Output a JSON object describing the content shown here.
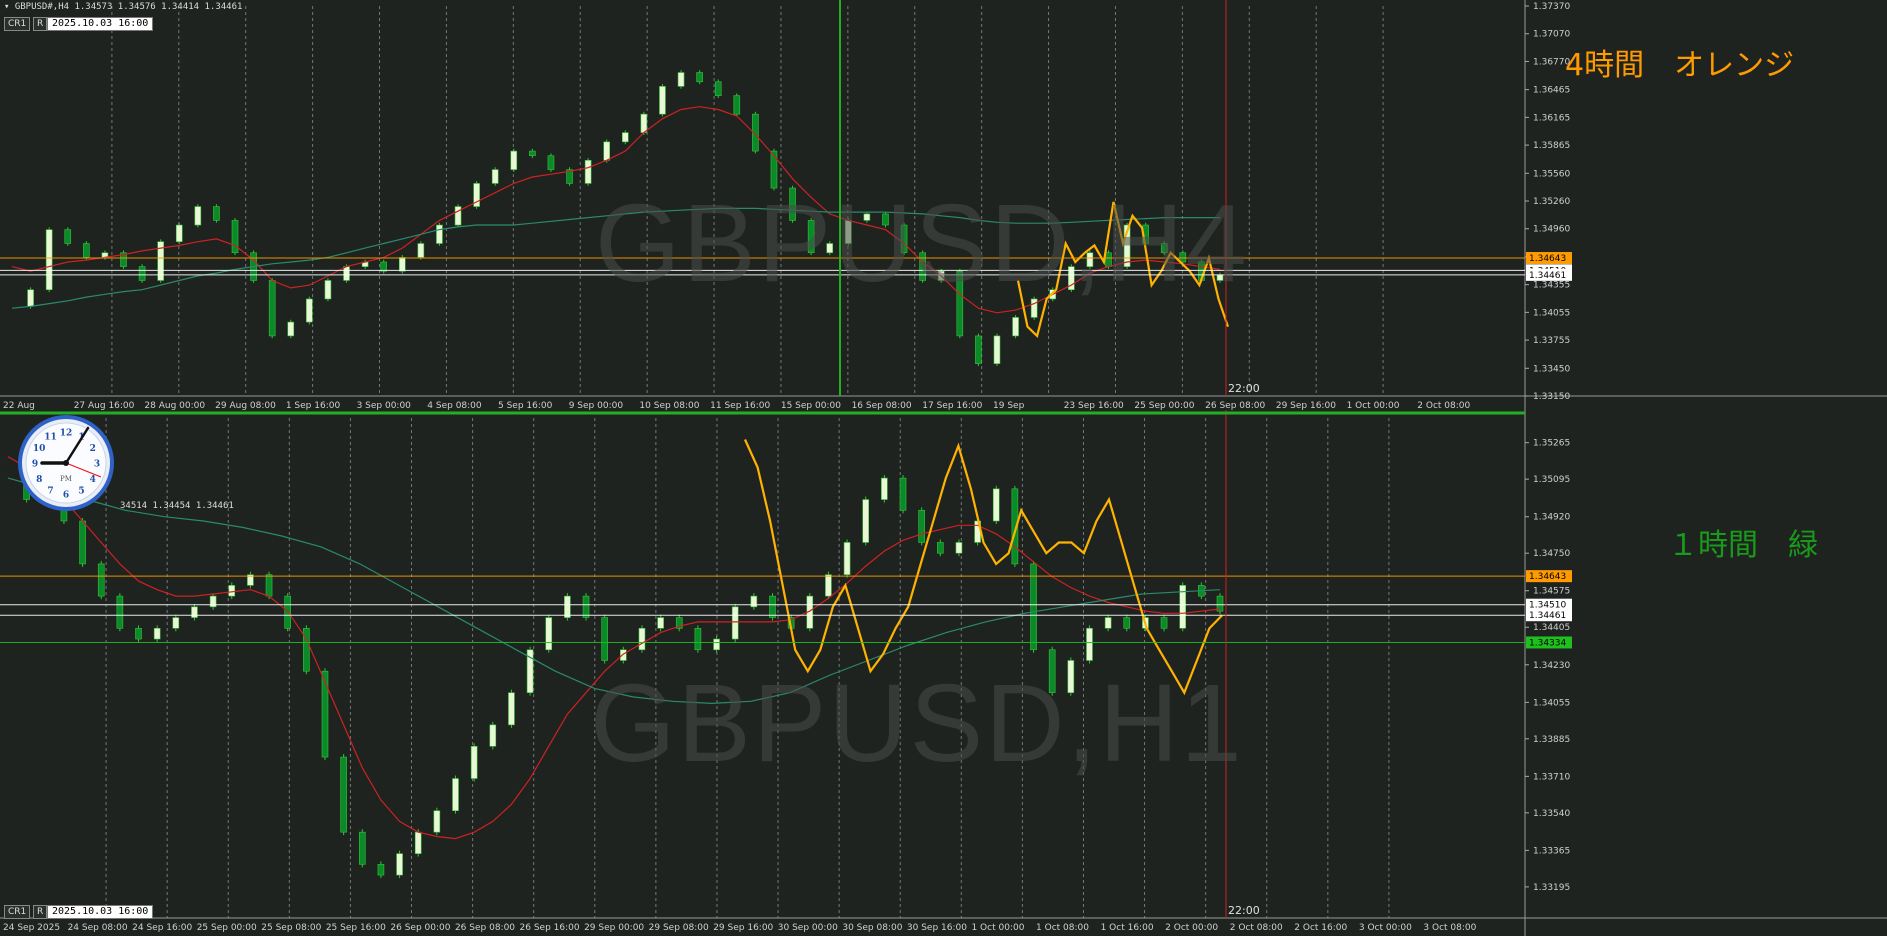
{
  "top": {
    "header_symbol": "GBPUSD#,H4",
    "header_ohlc": "1.34573 1.34576 1.34414 1.34461",
    "cr1_label": "CR1",
    "r_label": "R",
    "date_box": "2025.10.03 16:00",
    "watermark": "GBPUSD,H4",
    "note": "4時間　オレンジ",
    "note_color": "#ff9b00",
    "end_time_label": "22:00",
    "ylim": [
      1.3315,
      1.3737
    ],
    "price_ticks": [
      "1.37370",
      "1.37070",
      "1.36770",
      "1.36465",
      "1.36165",
      "1.35865",
      "1.35560",
      "1.35260",
      "1.34960",
      "1.34655",
      "1.34355",
      "1.34055",
      "1.33755",
      "1.33450",
      "1.33150"
    ],
    "time_ticks": [
      "22 Aug",
      "27 Aug 16:00",
      "28 Aug 00:00",
      "29 Aug 08:00",
      "1 Sep 16:00",
      "3 Sep 00:00",
      "4 Sep 08:00",
      "5 Sep 16:00",
      "9 Sep 00:00",
      "10 Sep 08:00",
      "11 Sep 16:00",
      "15 Sep 00:00",
      "16 Sep 08:00",
      "17 Sep 16:00",
      "19 Sep",
      "23 Sep 16:00",
      "25 Sep 00:00",
      "26 Sep 08:00",
      "29 Sep 16:00",
      "1 Oct 00:00",
      "2 Oct 08:00"
    ],
    "price_labels": [
      {
        "text": "1.34643",
        "value": 1.34643,
        "color": "#ff9b00"
      },
      {
        "text": "1.34510",
        "value": 1.3451,
        "color": "#ffffff"
      },
      {
        "text": "1.34461",
        "value": 1.34461,
        "color": "#ffffff"
      }
    ]
  },
  "bottom": {
    "header_ohlc": "34514 1.34454 1.34461",
    "cr1_label": "CR1",
    "r_label": "R",
    "date_box": "2025.10.03 16:00",
    "watermark": "GBPUSD,H1",
    "note": "１時間　緑",
    "note_color": "#1a9a1a",
    "end_time_label": "22:00",
    "ylim": [
      1.3305,
      1.3538
    ],
    "price_ticks": [
      "1.35265",
      "1.35095",
      "1.34920",
      "1.34750",
      "1.34575",
      "1.34405",
      "1.34230",
      "1.34055",
      "1.33885",
      "1.33710",
      "1.33540",
      "1.33365",
      "1.33195"
    ],
    "time_ticks": [
      "24 Sep 2025",
      "24 Sep 08:00",
      "24 Sep 16:00",
      "25 Sep 00:00",
      "25 Sep 08:00",
      "25 Sep 16:00",
      "26 Sep 00:00",
      "26 Sep 08:00",
      "26 Sep 16:00",
      "29 Sep 00:00",
      "29 Sep 08:00",
      "29 Sep 16:00",
      "30 Sep 00:00",
      "30 Sep 08:00",
      "30 Sep 16:00",
      "1 Oct 00:00",
      "1 Oct 08:00",
      "1 Oct 16:00",
      "2 Oct 00:00",
      "2 Oct 08:00",
      "2 Oct 16:00",
      "3 Oct 00:00",
      "3 Oct 08:00"
    ],
    "price_labels": [
      {
        "text": "1.34643",
        "value": 1.34643,
        "color": "#ff9b00"
      },
      {
        "text": "1.34510",
        "value": 1.3451,
        "color": "#ffffff"
      },
      {
        "text": "1.34461",
        "value": 1.34461,
        "color": "#ffffff"
      },
      {
        "text": "1.34334",
        "value": 1.34334,
        "color": "#1fbf1f"
      }
    ]
  },
  "clock": {
    "pm_label": "PM",
    "numbers": [
      "12",
      "1",
      "2",
      "3",
      "4",
      "5",
      "6",
      "7",
      "8",
      "9",
      "10",
      "11"
    ]
  },
  "chart_data": [
    {
      "type": "line",
      "title": "",
      "ylim": [
        1.3315,
        1.3737
      ],
      "series": [
        {
          "name": "",
          "y": [
            1.3412,
            1.343,
            1.3495,
            1.348,
            1.3465,
            1.347,
            1.3455,
            1.344,
            1.3482,
            1.35,
            1.352,
            1.3505,
            1.347,
            1.344,
            1.338,
            1.3395,
            1.342,
            1.344,
            1.3455,
            1.346,
            1.345,
            1.3465,
            1.348,
            1.35,
            1.352,
            1.3545,
            1.356,
            1.358,
            1.3575,
            1.356,
            1.3545,
            1.357,
            1.359,
            1.36,
            1.362,
            1.365,
            1.3665,
            1.3655,
            1.364,
            1.362,
            1.358,
            1.354,
            1.3505,
            1.347,
            1.348,
            1.3505,
            1.3512,
            1.35,
            1.347,
            1.344,
            1.345,
            1.338,
            1.335,
            1.338,
            1.34,
            1.342,
            1.343,
            1.3455,
            1.347,
            1.3455,
            1.35,
            1.348,
            1.347,
            1.346,
            1.344,
            1.3446
          ]
        },
        {
          "name": "",
          "y": [
            1.3455,
            1.345,
            1.3455,
            1.346,
            1.3462,
            1.3465,
            1.3468,
            1.3472,
            1.3475,
            1.3478,
            1.3482,
            1.3485,
            1.3478,
            1.3462,
            1.344,
            1.3432,
            1.3435,
            1.3445,
            1.3455,
            1.346,
            1.3465,
            1.3475,
            1.349,
            1.3505,
            1.3515,
            1.3525,
            1.3535,
            1.3545,
            1.3552,
            1.3555,
            1.3558,
            1.3562,
            1.357,
            1.358,
            1.36,
            1.3615,
            1.3625,
            1.3628,
            1.3625,
            1.3618,
            1.3598,
            1.3575,
            1.355,
            1.353,
            1.3512,
            1.3505,
            1.35,
            1.3495,
            1.348,
            1.346,
            1.3445,
            1.3425,
            1.341,
            1.3405,
            1.3408,
            1.3415,
            1.3425,
            1.3435,
            1.3448,
            1.3455,
            1.346,
            1.3462,
            1.346,
            1.3458,
            1.3455,
            1.3452
          ]
        },
        {
          "name": "",
          "y": [
            1.341,
            1.3412,
            1.3415,
            1.3418,
            1.3422,
            1.3425,
            1.3428,
            1.343,
            1.3435,
            1.344,
            1.3445,
            1.3448,
            1.3452,
            1.3455,
            1.3458,
            1.346,
            1.3462,
            1.3465,
            1.347,
            1.3475,
            1.348,
            1.3485,
            1.349,
            1.3495,
            1.3498,
            1.35,
            1.35,
            1.35,
            1.3502,
            1.3504,
            1.3506,
            1.3508,
            1.351,
            1.3512,
            1.3514,
            1.3515,
            1.3516,
            1.3517,
            1.3518,
            1.3518,
            1.3518,
            1.3517,
            1.3516,
            1.3515,
            1.3514,
            1.3514,
            1.3514,
            1.3514,
            1.3513,
            1.3512,
            1.351,
            1.3508,
            1.3505,
            1.3503,
            1.3502,
            1.3502,
            1.3502,
            1.3503,
            1.3504,
            1.3505,
            1.3506,
            1.3507,
            1.3508,
            1.3508,
            1.3508,
            1.3508
          ]
        },
        {
          "name": "",
          "y": [
            1.344,
            1.339,
            1.338,
            1.342,
            1.343,
            1.348,
            1.346,
            1.347,
            1.3478,
            1.346,
            1.3525,
            1.348,
            1.351,
            1.3497,
            1.3435,
            1.345,
            1.347,
            1.346,
            1.345,
            1.3435,
            1.3464,
            1.342,
            1.339
          ]
        }
      ]
    },
    {
      "type": "line",
      "title": "",
      "ylim": [
        1.3305,
        1.3538
      ],
      "series": [
        {
          "name": "",
          "y": [
            1.351,
            1.35,
            1.3505,
            1.349,
            1.347,
            1.3455,
            1.344,
            1.3435,
            1.344,
            1.3445,
            1.345,
            1.3455,
            1.346,
            1.3465,
            1.3455,
            1.344,
            1.342,
            1.338,
            1.3345,
            1.333,
            1.3325,
            1.3335,
            1.3345,
            1.3355,
            1.337,
            1.3385,
            1.3395,
            1.341,
            1.343,
            1.3445,
            1.3455,
            1.3445,
            1.3425,
            1.343,
            1.344,
            1.3445,
            1.344,
            1.343,
            1.3435,
            1.345,
            1.3455,
            1.3445,
            1.344,
            1.3455,
            1.3465,
            1.348,
            1.35,
            1.351,
            1.3495,
            1.348,
            1.3475,
            1.348,
            1.349,
            1.3505,
            1.347,
            1.343,
            1.341,
            1.3425,
            1.344,
            1.3445,
            1.344,
            1.3445,
            1.344,
            1.346,
            1.3455,
            1.3448
          ]
        },
        {
          "name": "",
          "y": [
            1.352,
            1.3515,
            1.3508,
            1.35,
            1.349,
            1.348,
            1.347,
            1.3462,
            1.3458,
            1.3455,
            1.3455,
            1.3456,
            1.3457,
            1.3458,
            1.3455,
            1.3448,
            1.3435,
            1.3415,
            1.3395,
            1.3375,
            1.336,
            1.335,
            1.3345,
            1.3343,
            1.3342,
            1.3345,
            1.335,
            1.3358,
            1.337,
            1.3385,
            1.34,
            1.341,
            1.342,
            1.3428,
            1.3433,
            1.3438,
            1.3441,
            1.3443,
            1.3443,
            1.3443,
            1.3443,
            1.3443,
            1.3444,
            1.3448,
            1.3454,
            1.3461,
            1.3469,
            1.3476,
            1.3481,
            1.3484,
            1.3486,
            1.3488,
            1.3488,
            1.3484,
            1.3478,
            1.3471,
            1.3464,
            1.3459,
            1.3455,
            1.3452,
            1.345,
            1.3448,
            1.3447,
            1.3447,
            1.3448,
            1.3449
          ]
        },
        {
          "name": "",
          "y": [
            1.351,
            1.3505,
            1.35,
            1.3495,
            1.3492,
            1.349,
            1.3487,
            1.3483,
            1.3478,
            1.347,
            1.346,
            1.345,
            1.344,
            1.343,
            1.342,
            1.3412,
            1.3408,
            1.3406,
            1.3405,
            1.3406,
            1.341,
            1.3418,
            1.3425,
            1.3432,
            1.3438,
            1.3443,
            1.3447,
            1.345,
            1.3453,
            1.3456,
            1.3457,
            1.3458
          ]
        },
        {
          "name": "",
          "y": [
            1.3528,
            1.3515,
            1.349,
            1.346,
            1.343,
            1.342,
            1.343,
            1.345,
            1.346,
            1.344,
            1.342,
            1.3428,
            1.344,
            1.345,
            1.347,
            1.349,
            1.351,
            1.3525,
            1.3505,
            1.348,
            1.347,
            1.3475,
            1.3495,
            1.3485,
            1.3475,
            1.348,
            1.348,
            1.3475,
            1.349,
            1.35,
            1.348,
            1.346,
            1.344,
            1.343,
            1.342,
            1.341,
            1.3425,
            1.344,
            1.3446
          ]
        }
      ]
    }
  ]
}
